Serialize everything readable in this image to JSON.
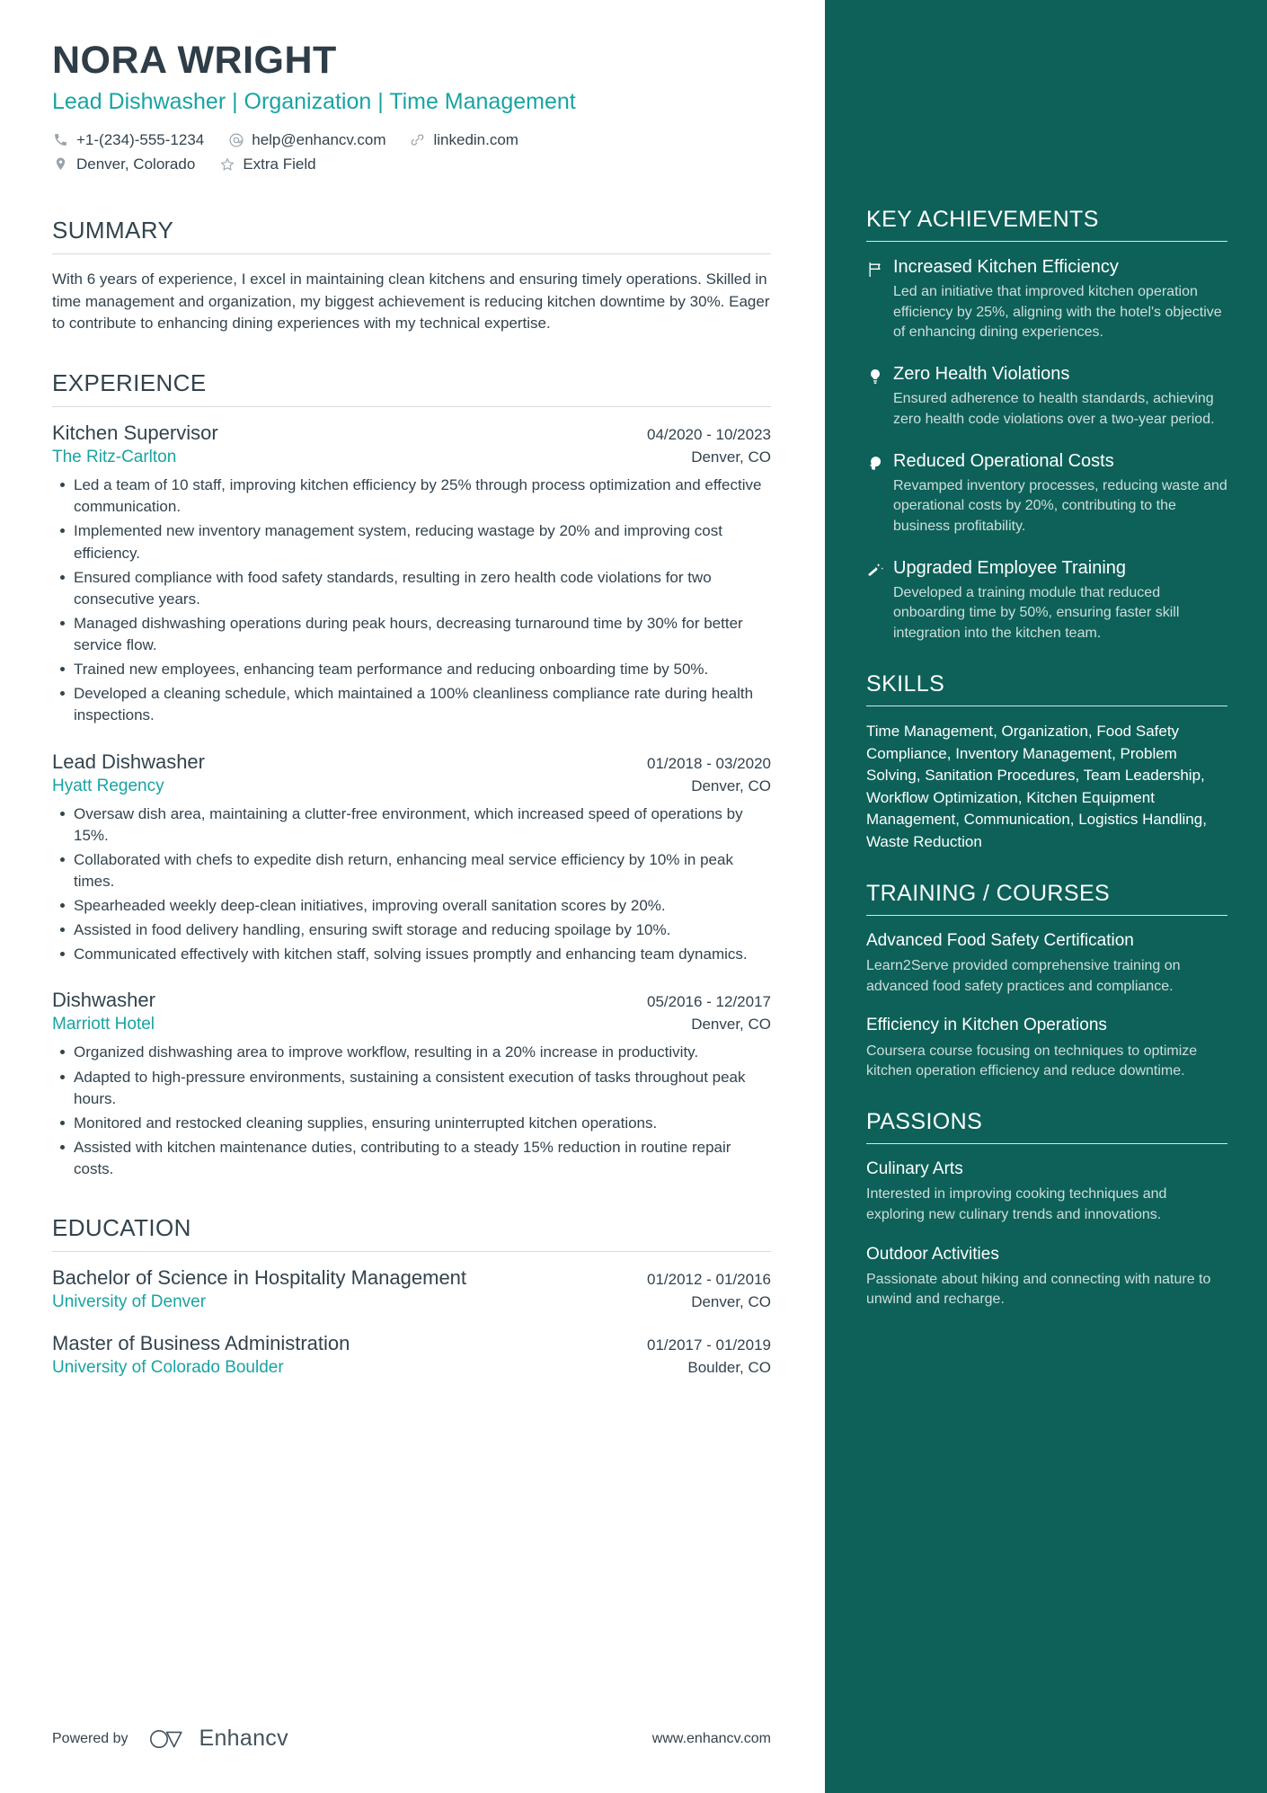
{
  "header": {
    "name": "NORA WRIGHT",
    "headline": "Lead Dishwasher | Organization | Time Management",
    "contacts": [
      {
        "icon": "phone-icon",
        "text": "+1-(234)-555-1234"
      },
      {
        "icon": "email-icon",
        "text": "help@enhancv.com"
      },
      {
        "icon": "link-icon",
        "text": "linkedin.com"
      },
      {
        "icon": "location-icon",
        "text": "Denver, Colorado"
      },
      {
        "icon": "star-icon",
        "text": "Extra Field"
      }
    ]
  },
  "summary": {
    "title": "SUMMARY",
    "text": "With 6 years of experience, I excel in maintaining clean kitchens and ensuring timely operations. Skilled in time management and organization, my biggest achievement is reducing kitchen downtime by 30%. Eager to contribute to enhancing dining experiences with my technical expertise."
  },
  "experience": {
    "title": "EXPERIENCE",
    "entries": [
      {
        "role": "Kitchen Supervisor",
        "dates": "04/2020 - 10/2023",
        "company": "The Ritz-Carlton",
        "location": "Denver, CO",
        "bullets": [
          "Led a team of 10 staff, improving kitchen efficiency by 25% through process optimization and effective communication.",
          "Implemented new inventory management system, reducing wastage by 20% and improving cost efficiency.",
          "Ensured compliance with food safety standards, resulting in zero health code violations for two consecutive years.",
          "Managed dishwashing operations during peak hours, decreasing turnaround time by 30% for better service flow.",
          "Trained new employees, enhancing team performance and reducing onboarding time by 50%.",
          "Developed a cleaning schedule, which maintained a 100% cleanliness compliance rate during health inspections."
        ]
      },
      {
        "role": "Lead Dishwasher",
        "dates": "01/2018 - 03/2020",
        "company": "Hyatt Regency",
        "location": "Denver, CO",
        "bullets": [
          "Oversaw dish area, maintaining a clutter-free environment, which increased speed of operations by 15%.",
          "Collaborated with chefs to expedite dish return, enhancing meal service efficiency by 10% in peak times.",
          "Spearheaded weekly deep-clean initiatives, improving overall sanitation scores by 20%.",
          "Assisted in food delivery handling, ensuring swift storage and reducing spoilage by 10%.",
          "Communicated effectively with kitchen staff, solving issues promptly and enhancing team dynamics."
        ]
      },
      {
        "role": "Dishwasher",
        "dates": "05/2016 - 12/2017",
        "company": "Marriott Hotel",
        "location": "Denver, CO",
        "bullets": [
          "Organized dishwashing area to improve workflow, resulting in a 20% increase in productivity.",
          "Adapted to high-pressure environments, sustaining a consistent execution of tasks throughout peak hours.",
          "Monitored and restocked cleaning supplies, ensuring uninterrupted kitchen operations.",
          "Assisted with kitchen maintenance duties, contributing to a steady 15% reduction in routine repair costs."
        ]
      }
    ]
  },
  "education": {
    "title": "EDUCATION",
    "entries": [
      {
        "degree": "Bachelor of Science in Hospitality Management",
        "dates": "01/2012 - 01/2016",
        "school": "University of Denver",
        "location": "Denver, CO"
      },
      {
        "degree": "Master of Business Administration",
        "dates": "01/2017 - 01/2019",
        "school": "University of Colorado Boulder",
        "location": "Boulder, CO"
      }
    ]
  },
  "achievements": {
    "title": "KEY ACHIEVEMENTS",
    "items": [
      {
        "icon": "flag-icon",
        "title": "Increased Kitchen Efficiency",
        "desc": "Led an initiative that improved kitchen operation efficiency by 25%, aligning with the hotel's objective of enhancing dining experiences."
      },
      {
        "icon": "lightbulb-icon",
        "title": "Zero Health Violations",
        "desc": "Ensured adherence to health standards, achieving zero health code violations over a two-year period."
      },
      {
        "icon": "idea-head-icon",
        "title": "Reduced Operational Costs",
        "desc": "Revamped inventory processes, reducing waste and operational costs by 20%, contributing to the business profitability."
      },
      {
        "icon": "magic-wand-icon",
        "title": "Upgraded Employee Training",
        "desc": "Developed a training module that reduced onboarding time by 50%, ensuring faster skill integration into the kitchen team."
      }
    ]
  },
  "skills": {
    "title": "SKILLS",
    "text": "Time Management, Organization, Food Safety Compliance, Inventory Management, Problem Solving, Sanitation Procedures, Team Leadership, Workflow Optimization, Kitchen Equipment Management, Communication, Logistics Handling, Waste Reduction"
  },
  "training": {
    "title": "TRAINING / COURSES",
    "items": [
      {
        "title": "Advanced Food Safety Certification",
        "desc": "Learn2Serve provided comprehensive training on advanced food safety practices and compliance."
      },
      {
        "title": "Efficiency in Kitchen Operations",
        "desc": "Coursera course focusing on techniques to optimize kitchen operation efficiency and reduce downtime."
      }
    ]
  },
  "passions": {
    "title": "PASSIONS",
    "items": [
      {
        "title": "Culinary Arts",
        "desc": "Interested in improving cooking techniques and exploring new culinary trends and innovations."
      },
      {
        "title": "Outdoor Activities",
        "desc": "Passionate about hiking and connecting with nature to unwind and recharge."
      }
    ]
  },
  "footer": {
    "powered_by": "Powered by",
    "brand": "Enhancv",
    "site": "www.enhancv.com"
  },
  "colors": {
    "accent_teal": "#19a3a3",
    "sidebar_teal": "#0d6159",
    "text_dark": "#33434d"
  }
}
